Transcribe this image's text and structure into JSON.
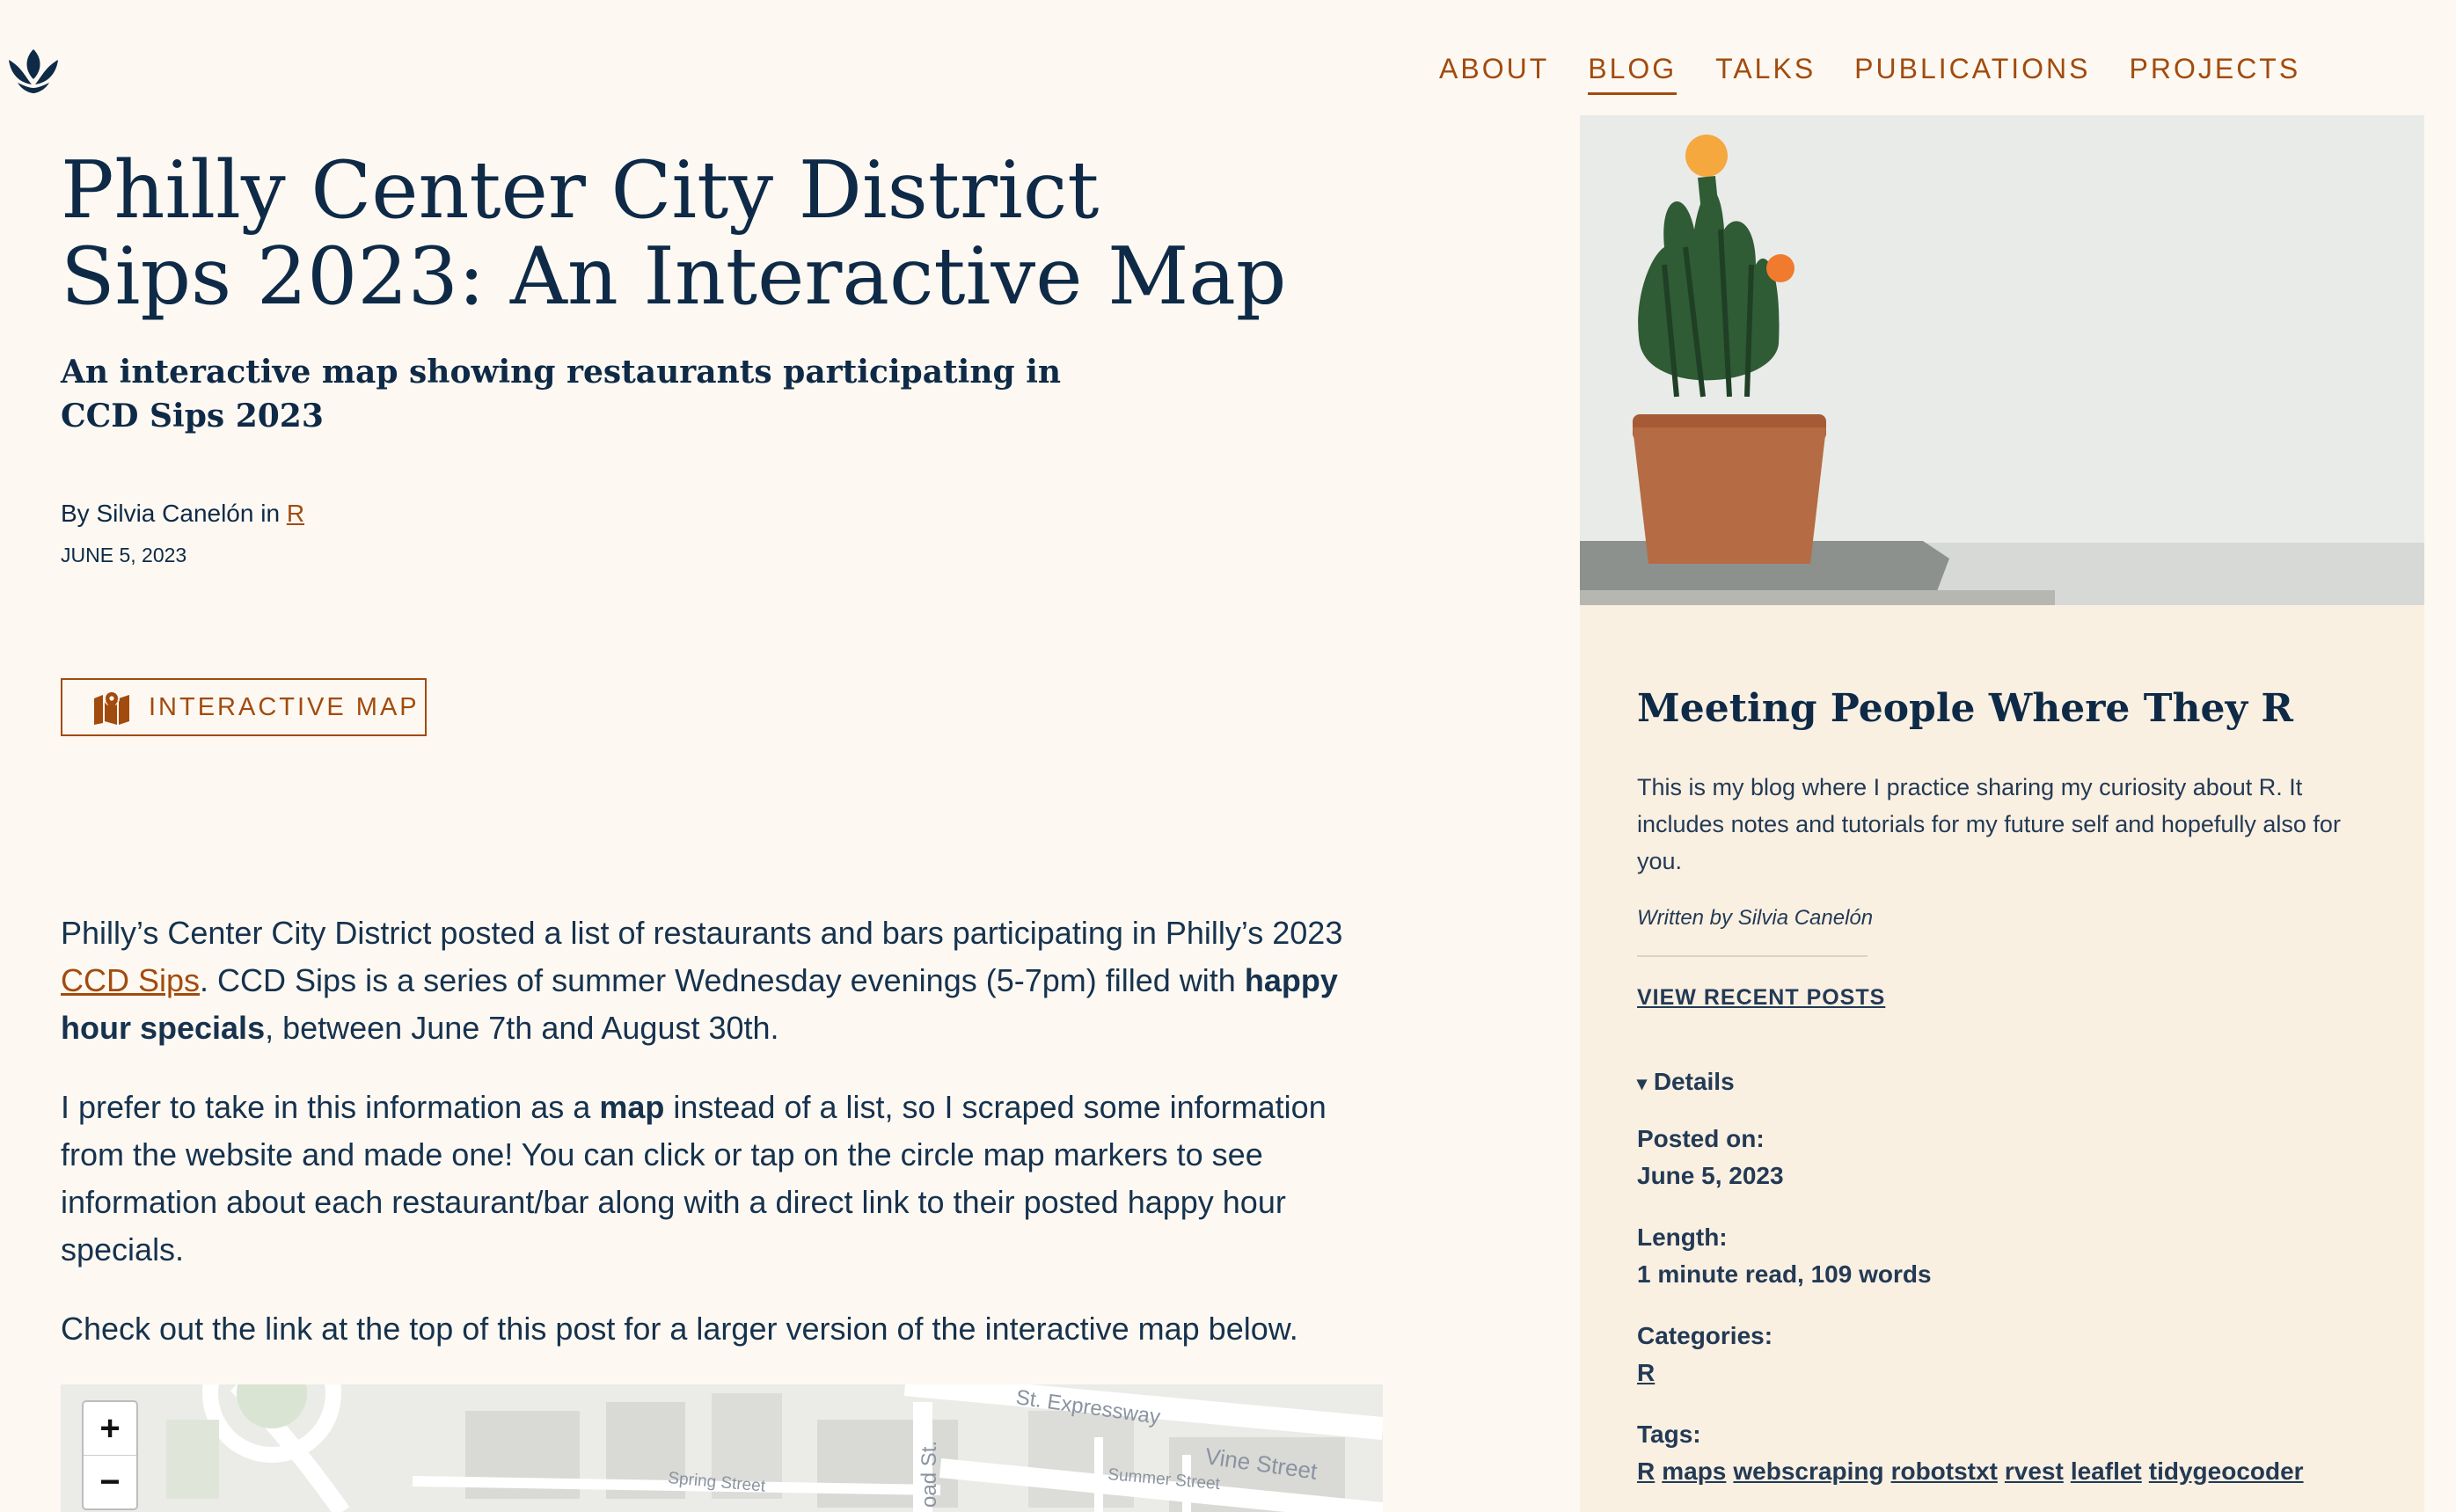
{
  "nav": {
    "items": [
      {
        "label": "ABOUT"
      },
      {
        "label": "BLOG"
      },
      {
        "label": "TALKS"
      },
      {
        "label": "PUBLICATIONS"
      },
      {
        "label": "PROJECTS"
      }
    ]
  },
  "post": {
    "title": "Philly Center City District Sips 2023: An Interactive Map",
    "subtitle": "An interactive map showing restaurants participating in CCD Sips 2023",
    "byline_prefix": "By Silvia Canelón in",
    "category_link": "R",
    "date": "JUNE 5, 2023",
    "button_label": "INTERACTIVE MAP",
    "p1_a": "Philly’s Center City District posted a list of restaurants and bars participating in Philly’s 2023",
    "p1_link": "CCD Sips",
    "p1_b": ". CCD Sips is a series of summer Wednesday evenings (5-7pm) filled with",
    "p1_bold": "happy hour specials",
    "p1_c": ", between June 7th and August 30th.",
    "p2_a": "I prefer to take in this information as a",
    "p2_bold": "map",
    "p2_b": "instead of a list, so I scraped some information from the website and made one! You can click or tap on the circle map markers to see information about each restaurant/bar along with a direct link to their posted happy hour specials.",
    "p3": "Check out the link at the top of this post for a larger version of the interactive map below."
  },
  "map": {
    "zoom_in": "+",
    "zoom_out": "−",
    "streets": [
      "St. Expressway",
      "Vine Street",
      "Spring Street",
      "Summer Street",
      "oad St."
    ]
  },
  "sidebar": {
    "title": "Meeting People Where They R",
    "description": "This is my blog where I practice sharing my curiosity about R. It includes notes and tutorials for my future self and hopefully also for you.",
    "written_by": "Written by Silvia Canelón",
    "recent_link": "VIEW RECENT POSTS",
    "details_label": "Details",
    "posted_on_label": "Posted on:",
    "posted_on": "June 5, 2023",
    "length_label": "Length:",
    "length": "1 minute read, 109 words",
    "categories_label": "Categories:",
    "categories": [
      "R"
    ],
    "tags_label": "Tags:",
    "tags": [
      "R",
      "maps",
      "webscraping",
      "robotstxt",
      "rvest",
      "leaflet",
      "tidygeocoder"
    ]
  },
  "colors": {
    "accent": "#a24b0e",
    "ink": "#0e2a47",
    "background": "#fdf9f2",
    "sidebar_bg": "#faf0e2"
  }
}
